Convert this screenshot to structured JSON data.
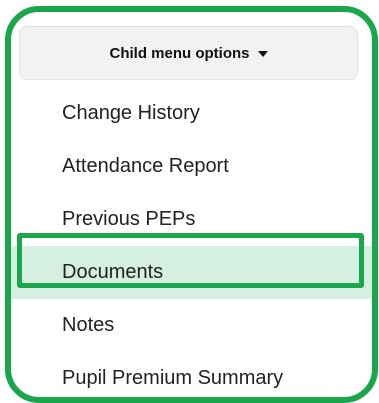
{
  "menu": {
    "toggle_label": "Child menu options",
    "toggle_icon": "caret-down-icon",
    "items": [
      {
        "label": "Change History",
        "active": false
      },
      {
        "label": "Attendance Report",
        "active": false
      },
      {
        "label": "Previous PEPs",
        "active": false
      },
      {
        "label": "Documents",
        "active": true
      },
      {
        "label": "Notes",
        "active": false
      },
      {
        "label": "Pupil Premium Summary",
        "active": false
      }
    ]
  },
  "colors": {
    "frame_border": "#1aa64a",
    "active_background": "#d5efe0",
    "toggle_background": "#f1f2f2"
  }
}
